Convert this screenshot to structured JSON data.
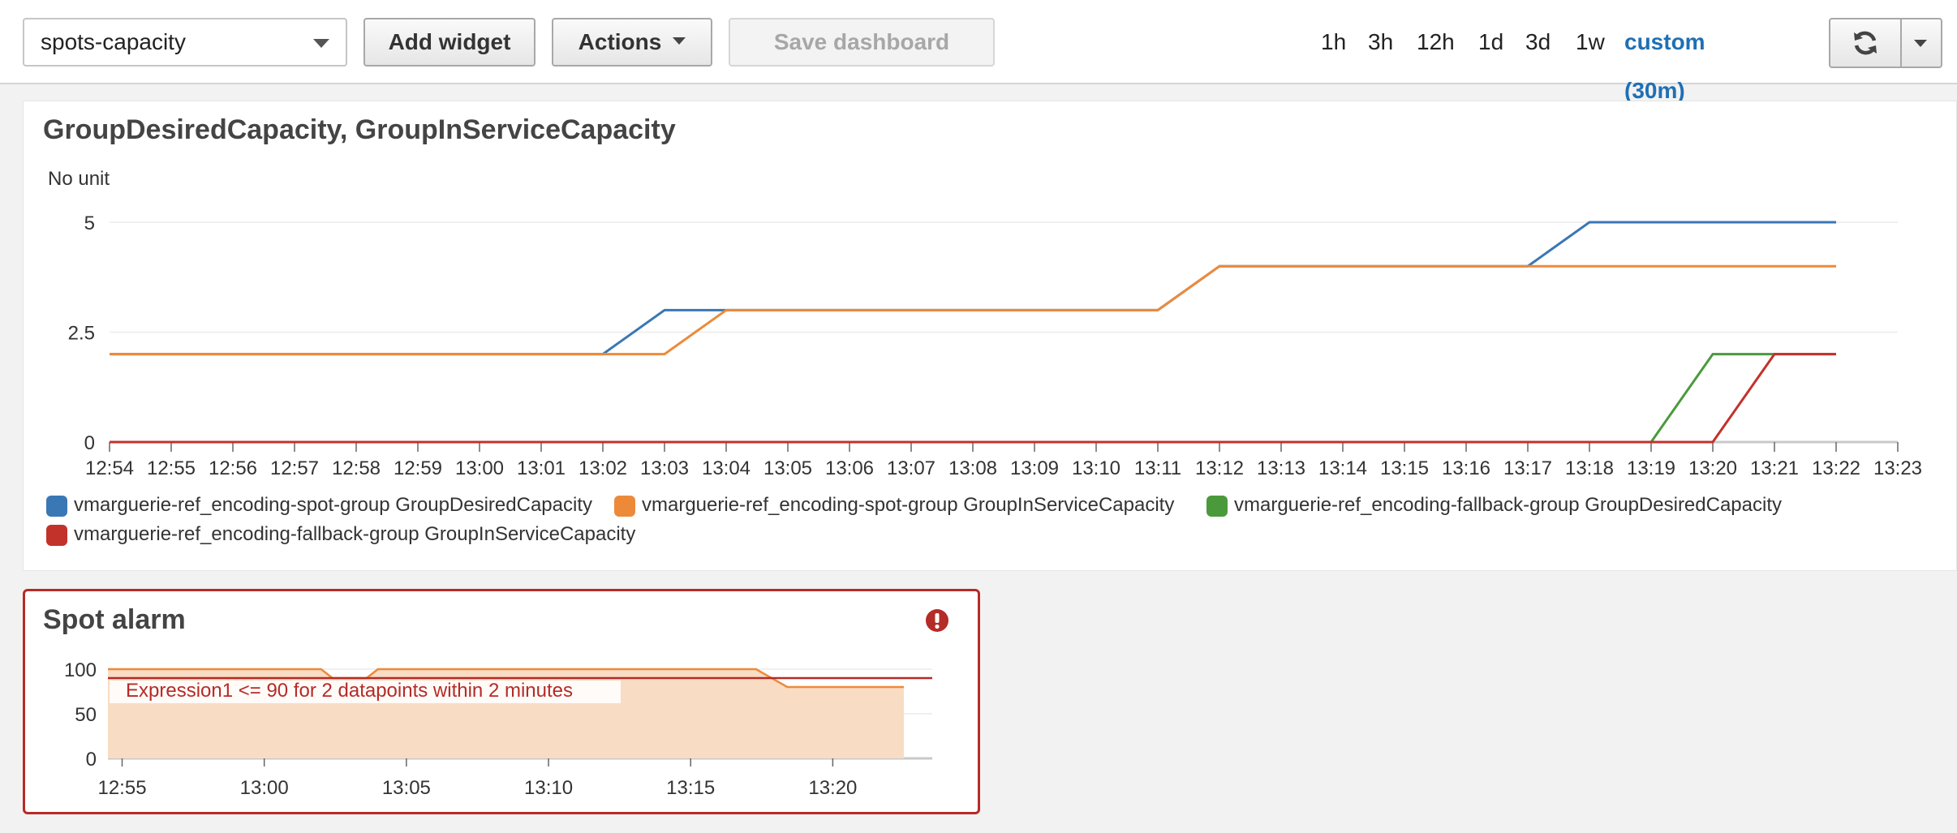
{
  "toolbar": {
    "dashboard_select": "spots-capacity",
    "add_widget": "Add widget",
    "actions": "Actions",
    "save_dashboard": "Save dashboard",
    "ranges": [
      "1h",
      "3h",
      "12h",
      "1d",
      "3d",
      "1w"
    ],
    "custom_range": "custom (30m)",
    "refresh_icon": "refresh-icon"
  },
  "widget1": {
    "title": "GroupDesiredCapacity, GroupInServiceCapacity",
    "unit": "No unit"
  },
  "widget2": {
    "title": "Spot alarm",
    "alarm_icon": "exclamation-circle-icon",
    "alarm_label": "Expression1 <= 90 for 2 datapoints within 2 minutes"
  },
  "colors": {
    "blue": "#3a77b5",
    "orange": "#ed8a3a",
    "green": "#4a9a3c",
    "red": "#c2322b",
    "alarm_border": "#b52b27",
    "accent": "#1f6fb5"
  },
  "chart_data": [
    {
      "type": "line",
      "x": [
        "12:54",
        "12:55",
        "12:56",
        "12:57",
        "12:58",
        "12:59",
        "13:00",
        "13:01",
        "13:02",
        "13:03",
        "13:04",
        "13:05",
        "13:06",
        "13:07",
        "13:08",
        "13:09",
        "13:10",
        "13:11",
        "13:12",
        "13:13",
        "13:14",
        "13:15",
        "13:16",
        "13:17",
        "13:18",
        "13:19",
        "13:20",
        "13:21",
        "13:22",
        "13:23"
      ],
      "ylim": [
        0,
        5
      ],
      "yticks": [
        "5",
        "2.5",
        "0"
      ],
      "grid": true,
      "legend": "bottom",
      "series": [
        {
          "name": "vmarguerie-ref_encoding-spot-group GroupDesiredCapacity",
          "color": "#3a77b5",
          "values": [
            2,
            2,
            2,
            2,
            2,
            2,
            2,
            2,
            2,
            3,
            3,
            3,
            3,
            3,
            3,
            3,
            3,
            3,
            4,
            4,
            4,
            4,
            4,
            4,
            5,
            5,
            5,
            5,
            5
          ]
        },
        {
          "name": "vmarguerie-ref_encoding-spot-group GroupInServiceCapacity",
          "color": "#ed8a3a",
          "values": [
            2,
            2,
            2,
            2,
            2,
            2,
            2,
            2,
            2,
            2,
            3,
            3,
            3,
            3,
            3,
            3,
            3,
            3,
            4,
            4,
            4,
            4,
            4,
            4,
            4,
            4,
            4,
            4,
            4
          ]
        },
        {
          "name": "vmarguerie-ref_encoding-fallback-group GroupDesiredCapacity",
          "color": "#4a9a3c",
          "values": [
            0,
            0,
            0,
            0,
            0,
            0,
            0,
            0,
            0,
            0,
            0,
            0,
            0,
            0,
            0,
            0,
            0,
            0,
            0,
            0,
            0,
            0,
            0,
            0,
            0,
            0,
            2,
            2,
            2
          ]
        },
        {
          "name": "vmarguerie-ref_encoding-fallback-group GroupInServiceCapacity",
          "color": "#c2322b",
          "values": [
            0,
            0,
            0,
            0,
            0,
            0,
            0,
            0,
            0,
            0,
            0,
            0,
            0,
            0,
            0,
            0,
            0,
            0,
            0,
            0,
            0,
            0,
            0,
            0,
            0,
            0,
            0,
            2,
            2
          ]
        }
      ]
    },
    {
      "type": "area",
      "x_ticks": [
        "12:55",
        "13:00",
        "13:05",
        "13:10",
        "13:15",
        "13:20"
      ],
      "yticks": [
        "100",
        "50",
        "0"
      ],
      "ylim": [
        0,
        100
      ],
      "threshold": 90,
      "x_start_minute": 54.5,
      "x_end_minute": 83.5,
      "points": [
        [
          54.5,
          100
        ],
        [
          62,
          100
        ],
        [
          62.4,
          90
        ],
        [
          63.6,
          90
        ],
        [
          64,
          100
        ],
        [
          71,
          100
        ],
        [
          71.4,
          100
        ],
        [
          72.4,
          100
        ],
        [
          80,
          100
        ],
        [
          80.7,
          100
        ],
        [
          81.7,
          80
        ],
        [
          82.5,
          80
        ],
        [
          82.5,
          0
        ]
      ],
      "series": [
        {
          "color": "#ed8a3a",
          "points": [
            [
              54.5,
              100
            ],
            [
              62,
              100
            ],
            [
              62.4,
              90
            ],
            [
              63.6,
              90
            ],
            [
              64,
              100
            ],
            [
              71,
              100
            ],
            [
              72.4,
              100
            ],
            [
              77.3,
              100
            ],
            [
              78.4,
              80
            ],
            [
              82.5,
              80
            ]
          ]
        }
      ]
    }
  ]
}
